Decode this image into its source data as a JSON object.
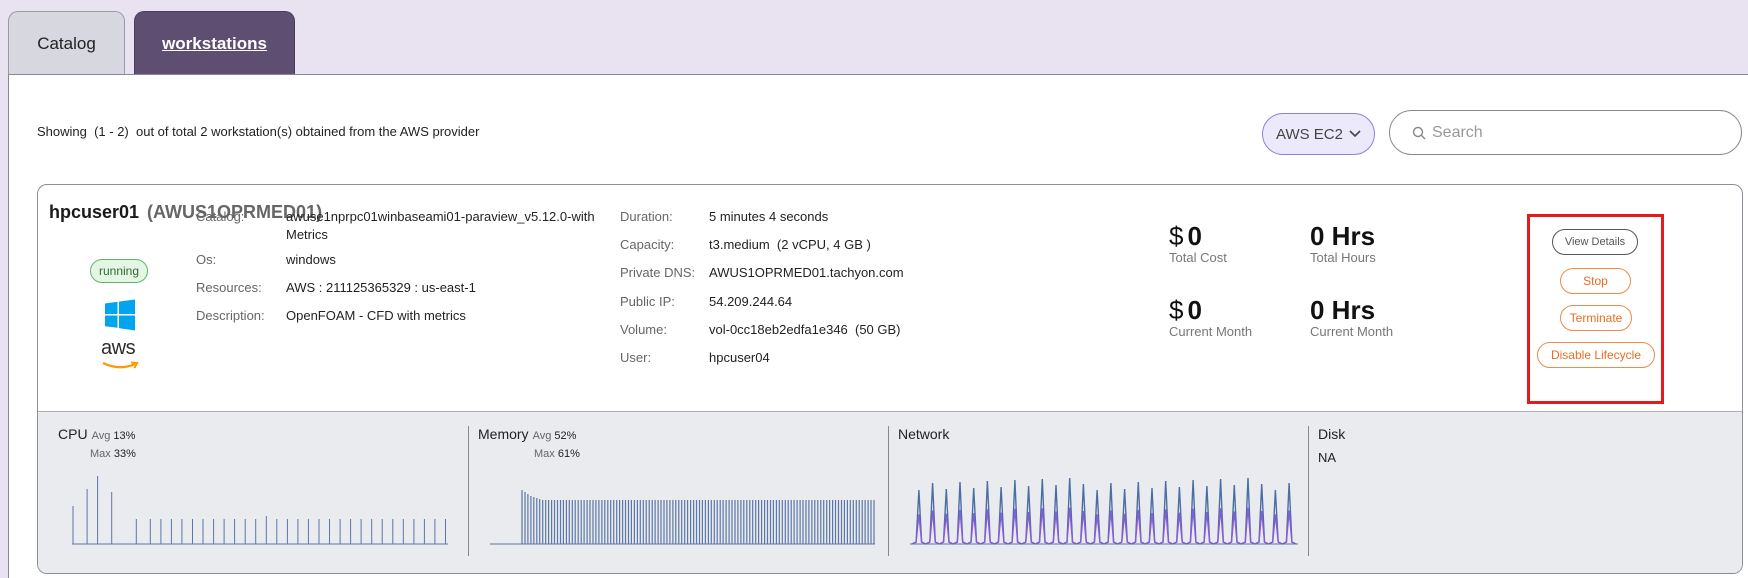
{
  "tabs": [
    {
      "label": "Catalog"
    },
    {
      "label": "workstations"
    }
  ],
  "toolbar": {
    "showing_text": "Showing  (1 - 2)  out of total 2 workstation(s) obtained from the AWS provider",
    "provider_select": "AWS EC2",
    "search_placeholder": "Search"
  },
  "workstation": {
    "user": "hpcuser01",
    "host_id": "(AWUS1OPRMED01)",
    "status": "running",
    "os_icon": "windows-icon",
    "provider_logo": "aws",
    "left_fields": [
      {
        "key": "Catalog:",
        "value": "awuse1nprpc01winbaseami01-paraview_v5.12.0-with",
        "value2": "Metrics"
      },
      {
        "key": "Os:",
        "value": "windows"
      },
      {
        "key": "Resources:",
        "value": "AWS : 211125365329 : us-east-1"
      },
      {
        "key": "Description:",
        "value": "OpenFOAM - CFD with metrics"
      }
    ],
    "right_fields": [
      {
        "key": "Duration:",
        "value": "5 minutes 4 seconds"
      },
      {
        "key": "Capacity:",
        "value": "t3.medium  (2 vCPU, 4 GB )"
      },
      {
        "key": "Private DNS:",
        "value": "AWUS1OPRMED01.tachyon.com"
      },
      {
        "key": "Public IP:",
        "value": "54.209.244.64"
      },
      {
        "key": "Volume:",
        "value": "vol-0cc18eb2edfa1e346  (50 GB)"
      },
      {
        "key": "User:",
        "value": "hpcuser04"
      }
    ],
    "stats": {
      "total_cost": {
        "symbol": "$",
        "value": "0",
        "label": "Total Cost"
      },
      "total_hours": {
        "value": "0 Hrs",
        "label": "Total Hours"
      },
      "month_cost": {
        "symbol": "$",
        "value": "0",
        "label": "Current Month"
      },
      "month_hours": {
        "value": "0 Hrs",
        "label": "Current Month"
      }
    },
    "actions": {
      "view": "View Details",
      "stop": "Stop",
      "terminate": "Terminate",
      "disable": "Disable Lifecycle"
    },
    "metrics": {
      "cpu": {
        "title": "CPU",
        "avg_label": "Avg",
        "avg": "13%",
        "max_label": "Max",
        "max": "33%",
        "series": [
          38,
          0,
          0,
          0,
          55,
          0,
          0,
          68,
          0,
          0,
          0,
          52,
          0,
          0,
          0,
          0,
          0,
          0,
          25,
          0,
          0,
          0,
          25,
          0,
          0,
          25,
          0,
          0,
          25,
          0,
          0,
          25,
          0,
          0,
          25,
          0,
          0,
          25,
          0,
          0,
          25,
          0,
          0,
          25,
          0,
          0,
          25,
          0,
          0,
          25,
          0,
          0,
          25,
          0,
          0,
          28,
          0,
          0,
          25,
          0,
          0,
          25,
          0,
          0,
          25,
          0,
          0,
          25,
          0,
          0,
          25,
          0,
          0,
          25,
          0,
          0,
          25,
          0,
          0,
          25,
          0,
          0,
          25,
          0,
          0,
          25,
          0,
          0,
          25,
          0,
          0,
          25,
          0,
          0,
          25,
          0,
          0,
          25,
          0,
          0,
          25,
          0,
          0,
          25,
          0,
          0,
          25
        ]
      },
      "memory": {
        "title": "Memory",
        "avg_label": "Avg",
        "avg": "52%",
        "max_label": "Max",
        "max": "61%"
      },
      "network": {
        "title": "Network"
      },
      "disk": {
        "title": "Disk",
        "value": "NA"
      }
    },
    "colors": {
      "network_in": "#4a6fa5",
      "network_out": "#8a5bd6",
      "bars": "#5b76a8"
    }
  }
}
